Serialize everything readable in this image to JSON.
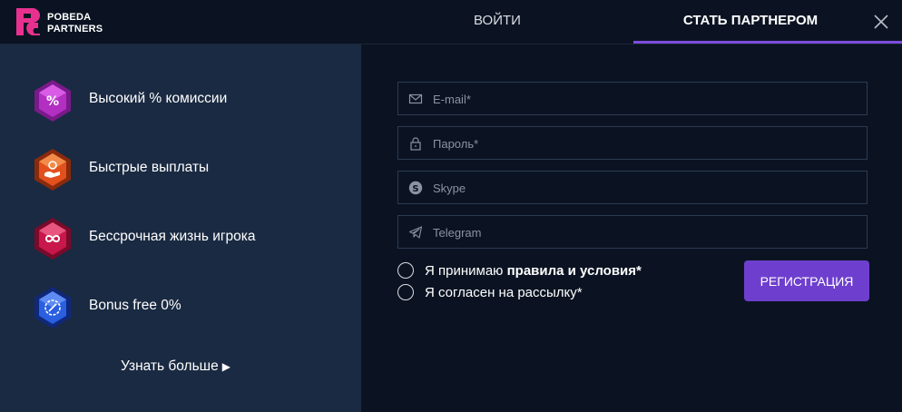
{
  "brand": {
    "line1": "POBEDA",
    "line2": "PARTNERS",
    "accent": "#e8318f"
  },
  "tabs": {
    "login": "ВОЙТИ",
    "partner": "СТАТЬ ПАРТНЕРОМ"
  },
  "features": [
    {
      "label": "Высокий % комиссии",
      "icon": "percent-gem-icon",
      "color": "#b22fc2"
    },
    {
      "label": "Быстрые выплаты",
      "icon": "payout-gem-icon",
      "color": "#e2501d"
    },
    {
      "label": "Бессрочная жизнь игрока",
      "icon": "infinity-gem-icon",
      "color": "#c8174a"
    },
    {
      "label": "Bonus free 0%",
      "icon": "badge-gem-icon",
      "color": "#2a5fe0"
    }
  ],
  "learn_more": "Узнать больше",
  "form": {
    "email_placeholder": "E-mail*",
    "password_placeholder": "Пароль*",
    "skype_placeholder": "Skype",
    "telegram_placeholder": "Telegram",
    "accept_prefix": "Я принимаю ",
    "accept_link": "правила и условия",
    "accept_suffix": "*",
    "newsletter": "Я согласен на рассылку*",
    "register_label": "РЕГИСТРАЦИЯ"
  },
  "colors": {
    "accent": "#7c4ddb",
    "button": "#6e3fce",
    "panel": "#1a2a42",
    "background": "#0b1322"
  }
}
